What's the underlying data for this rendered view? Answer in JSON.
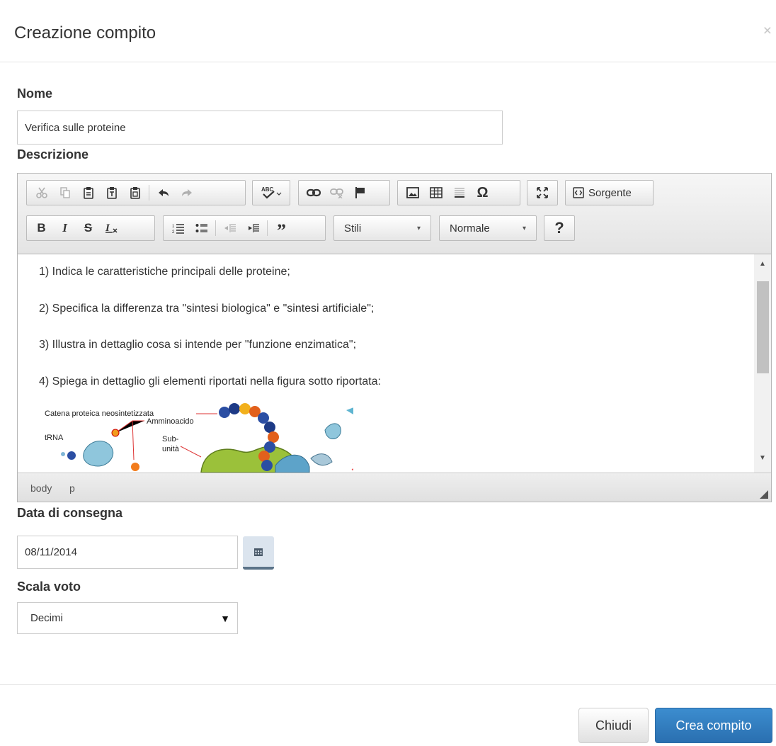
{
  "modal": {
    "title": "Creazione compito",
    "close_symbol": "×"
  },
  "form": {
    "name_label": "Nome",
    "name_value": "Verifica sulle proteine",
    "description_label": "Descrizione",
    "due_date_label": "Data di consegna",
    "due_date_value": "08/11/2014",
    "grade_scale_label": "Scala voto",
    "grade_scale_value": "Decimi"
  },
  "editor": {
    "source_button_label": "Sorgente",
    "styles_combo_label": "Stili",
    "format_combo_label": "Normale",
    "help_label": "?",
    "bold_label": "B",
    "italic_label": "I",
    "strike_label": "S",
    "content_lines": [
      "1) Indica le caratteristiche principali delle proteine;",
      "2) Specifica la differenza tra \"sintesi biologica\" e \"sintesi artificiale\";",
      "3) Illustra in dettaglio cosa si intende per \"funzione enzimatica\";",
      "4) Spiega in dettaglio gli elementi riportati nella figura sotto riportata:"
    ],
    "figure_labels": {
      "chain": "Catena proteica neosintetizzata",
      "amino": "Amminoacido",
      "trna": "tRNA",
      "sub1": "Sub-",
      "sub2": "unità"
    },
    "path": [
      "body",
      "p"
    ]
  },
  "footer": {
    "close_label": "Chiudi",
    "create_label": "Crea compito"
  },
  "colors": {
    "primary": "#2f7ec0",
    "calendar_button": "#dbe4ee"
  }
}
